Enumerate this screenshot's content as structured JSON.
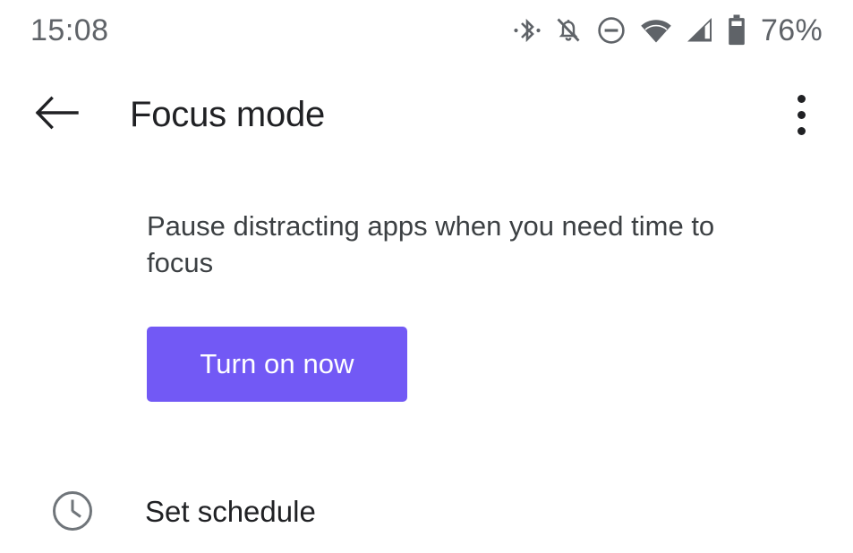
{
  "status_bar": {
    "time": "15:08",
    "battery_percent": "76%",
    "icons": [
      {
        "name": "bluetooth-icon"
      },
      {
        "name": "notifications-muted-icon"
      },
      {
        "name": "do-not-disturb-icon"
      },
      {
        "name": "wifi-icon"
      },
      {
        "name": "cellular-signal-icon"
      },
      {
        "name": "battery-icon"
      }
    ],
    "text_color": "#5f6368"
  },
  "app_bar": {
    "title": "Focus mode",
    "back_icon": "arrow-back-icon",
    "overflow_icon": "more-vert-icon"
  },
  "content": {
    "description": "Pause distracting apps when you need time to focus",
    "primary_button": {
      "label": "Turn on now",
      "color": "#7259f5"
    }
  },
  "list": {
    "items": [
      {
        "label": "Set schedule",
        "icon": "clock-icon"
      }
    ]
  }
}
